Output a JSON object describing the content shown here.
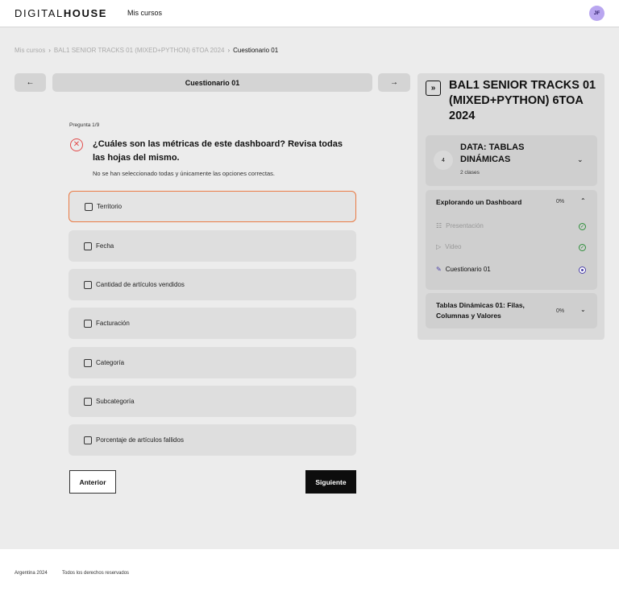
{
  "header": {
    "logo_light": "DIGITAL",
    "logo_bold": "HOUSE",
    "nav_link": "Mis cursos",
    "avatar_initials": "JF"
  },
  "breadcrumb": {
    "root": "Mis cursos",
    "course": "BAL1 SENIOR TRACKS 01 (MIXED+PYTHON) 6TOA 2024",
    "current": "Cuestionario 01"
  },
  "quiz_nav": {
    "prev_icon": "arrow-left",
    "title": "Cuestionario 01",
    "next_icon": "arrow-right"
  },
  "question": {
    "counter": "Pregunta 1/9",
    "text": "¿Cuáles son las métricas de este dashboard? Revisa todas las hojas del mismo.",
    "hint": "No se han seleccionado todas y únicamente las opciones correctas.",
    "status_icon": "error-circle-icon",
    "options": [
      {
        "label": "Territorio",
        "checked": false
      },
      {
        "label": "Fecha",
        "checked": false
      },
      {
        "label": "Cantidad de artículos vendidos",
        "checked": false
      },
      {
        "label": "Facturación",
        "checked": false
      },
      {
        "label": "Categoría",
        "checked": false
      },
      {
        "label": "Subcategoría",
        "checked": false
      },
      {
        "label": "Porcentaje de artículos fallidos",
        "checked": false
      }
    ]
  },
  "actions": {
    "prev_label": "Anterior",
    "next_label": "Siguiente"
  },
  "sidebar": {
    "course_title": "BAL1 SENIOR TRACKS 01 (MIXED+PYTHON) 6TOA 2024",
    "module": {
      "number": "4",
      "title": "DATA: TABLAS DINÁMICAS",
      "subtitle": "2 clases"
    },
    "lessons": [
      {
        "title": "Explorando un Dashboard",
        "progress": "0%",
        "expanded": true,
        "items": [
          {
            "label": "Presentación",
            "icon": "document-icon",
            "status": "completed"
          },
          {
            "label": "Video",
            "icon": "video-icon",
            "status": "completed"
          },
          {
            "label": "Cuestionario 01",
            "icon": "pencil-icon",
            "status": "current"
          }
        ]
      },
      {
        "title": "Tablas Dinámicas 01: Filas, Columnas y Valores",
        "progress": "0%",
        "expanded": false
      }
    ]
  },
  "footer": {
    "country_year": "Argentina 2024",
    "rights": "Todos los derechos reservados"
  },
  "colors": {
    "selected_border": "#ea7a44",
    "error": "#e24b4b",
    "completed": "#2f8f3b",
    "current": "#4a3fa8",
    "avatar_bg": "#b9a6f0"
  }
}
